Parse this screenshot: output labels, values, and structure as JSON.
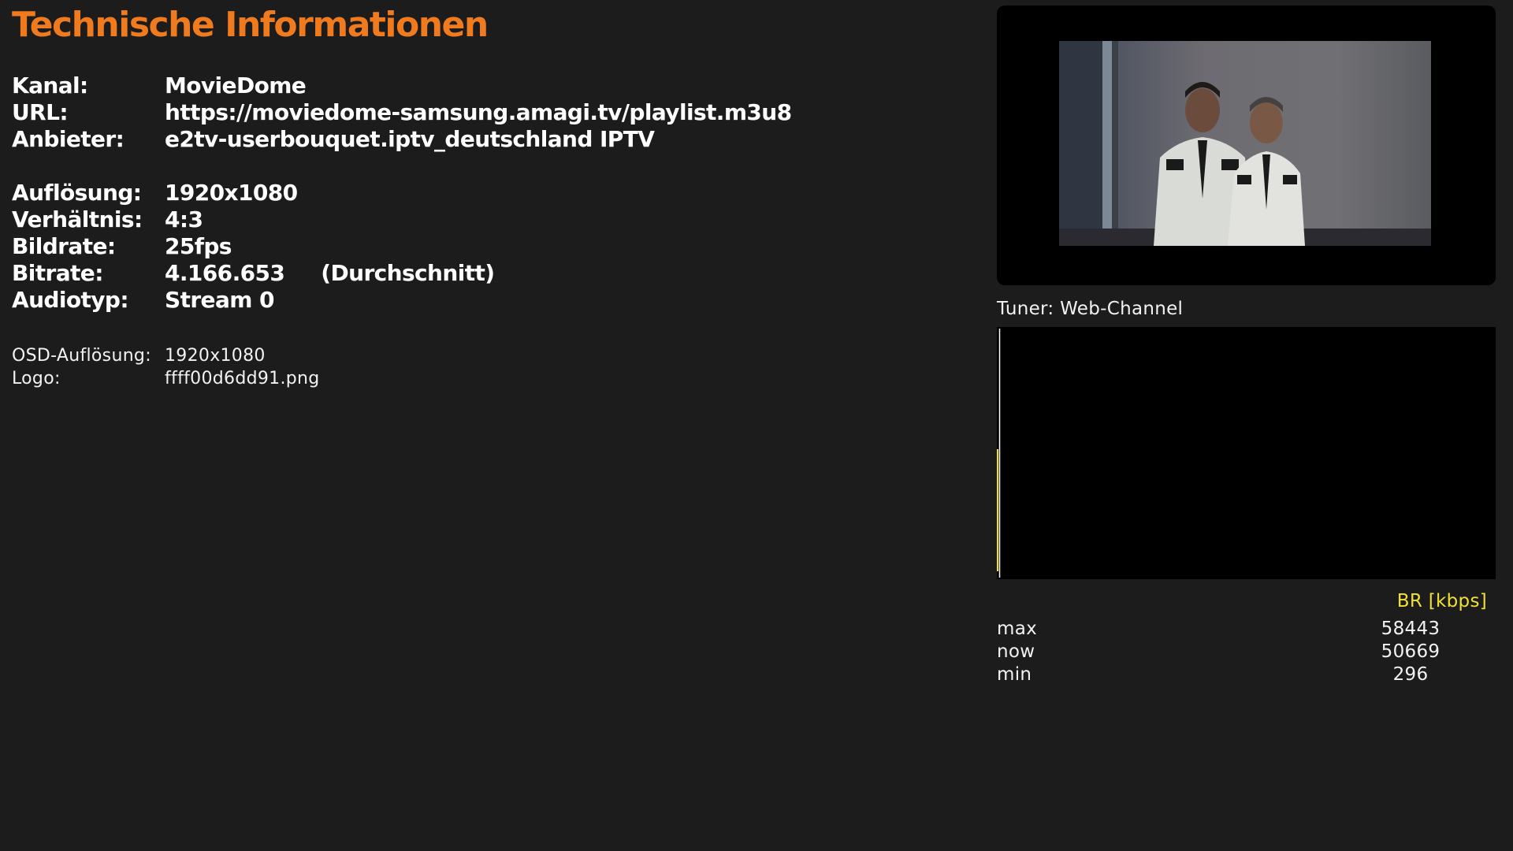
{
  "title": "Technische Informationen",
  "channel_info": [
    {
      "label": "Kanal:",
      "value": "MovieDome"
    },
    {
      "label": "URL:",
      "value": "https://moviedome-samsung.amagi.tv/playlist.m3u8"
    },
    {
      "label": "Anbieter:",
      "value": "e2tv-userbouquet.iptv_deutschland IPTV"
    }
  ],
  "video_info": [
    {
      "label": "Auflösung:",
      "value": "1920x1080"
    },
    {
      "label": "Verhältnis:",
      "value": "4:3"
    },
    {
      "label": "Bildrate:",
      "value": "25fps"
    },
    {
      "label": "Bitrate:",
      "value": "4.166.653",
      "note": "(Durchschnitt)"
    },
    {
      "label": "Audiotyp:",
      "value": "Stream 0"
    }
  ],
  "osd_info": [
    {
      "label": "OSD-Auflösung:",
      "value": "1920x1080"
    },
    {
      "label": "Logo:",
      "value": "ffff00d6dd91.png"
    }
  ],
  "tuner": "Tuner: Web-Channel",
  "bitrate_graph": {
    "unit_label": "BR [kbps]",
    "line_color": "#f0e030",
    "stats": [
      {
        "name": "max",
        "value": "58443"
      },
      {
        "name": "now",
        "value": "50669"
      },
      {
        "name": "min",
        "value": "296"
      }
    ]
  },
  "colors": {
    "background": "#1c1c1c",
    "title": "#f07a1e",
    "accent_yellow": "#f0e030"
  }
}
